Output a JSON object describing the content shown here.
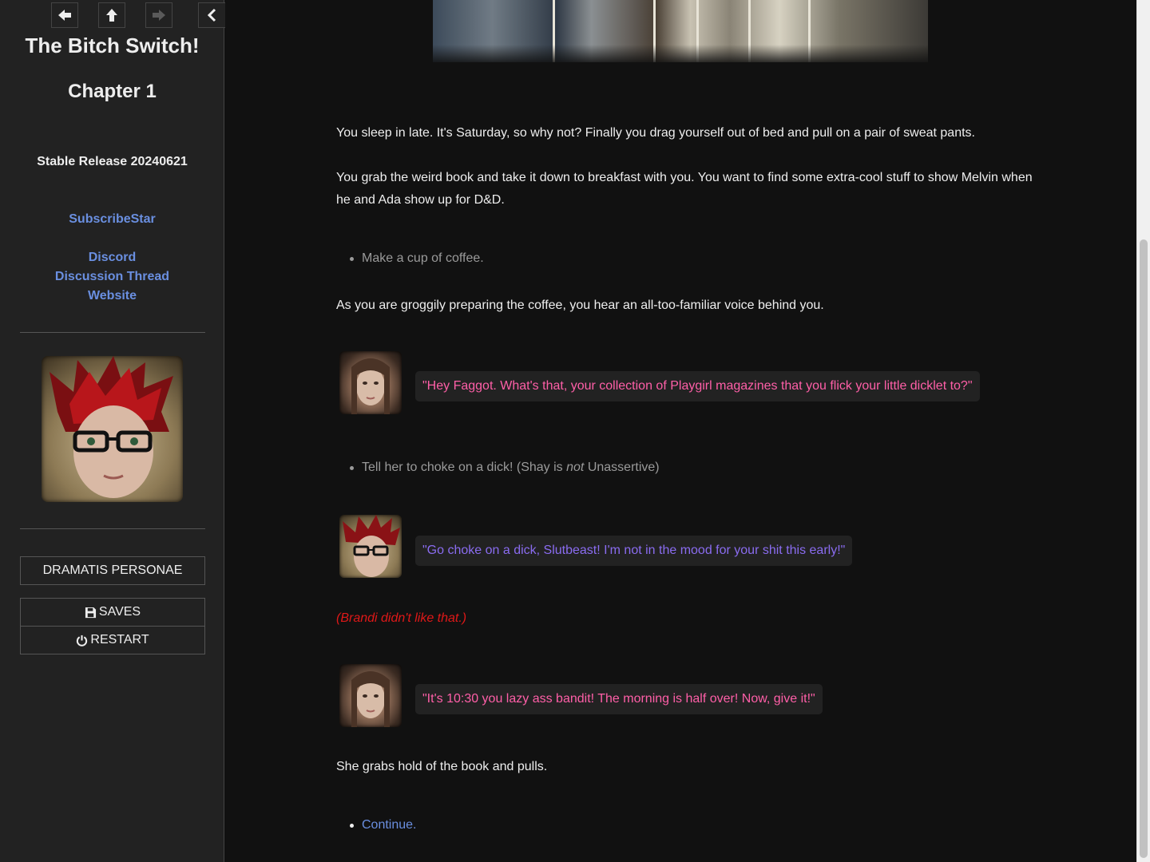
{
  "sidebar": {
    "title": "The Bitch Switch!",
    "chapter": "Chapter 1",
    "release": "Stable Release 20240621",
    "links": {
      "subscribestar": "SubscribeStar",
      "discord": "Discord",
      "discussion_thread": "Discussion Thread",
      "website": "Website"
    },
    "buttons": {
      "dramatis": "DRAMATIS PERSONAE",
      "saves": "SAVES",
      "restart": "RESTART"
    },
    "nav_icons": [
      "arrow-left-icon",
      "arrow-up-icon",
      "arrow-right-icon",
      "chevron-left-icon"
    ]
  },
  "passage": {
    "paragraph_1": "You sleep in late. It's Saturday, so why not? Finally you drag yourself out of bed and pull on a pair of sweat pants.",
    "paragraph_2": "You grab the weird book and take it down to breakfast with you. You want to find some extra-cool stuff to show Melvin when he and Ada show up for D&D.",
    "choice_1": "Make a cup of coffee.",
    "paragraph_3": "As you are groggily preparing the coffee, you hear an all-too-familiar voice behind you.",
    "dialogue_1": "\"Hey Faggot. What's that, your collection of Playgirl magazines that you flick your little dicklet to?\"",
    "choice_2_before": "Tell her to choke on a dick! (Shay is ",
    "choice_2_emph": "not",
    "choice_2_after": " Unassertive)",
    "dialogue_2": "\"Go choke on a dick, Slutbeast! I'm not in the mood for your shit this early!\"",
    "reaction": "(Brandi didn't like that.)",
    "dialogue_3": "\"It's 10:30 you lazy ass bandit! The morning is half over! Now, give it!\"",
    "paragraph_4": "She grabs hold of the book and pulls.",
    "continue": "Continue."
  },
  "colors": {
    "background": "#111111",
    "sidebar": "#222222",
    "link": "#6a8fe0",
    "brandi_speech": "#ff5fa8",
    "shay_speech": "#8a6cf0",
    "reaction": "#e01818"
  }
}
